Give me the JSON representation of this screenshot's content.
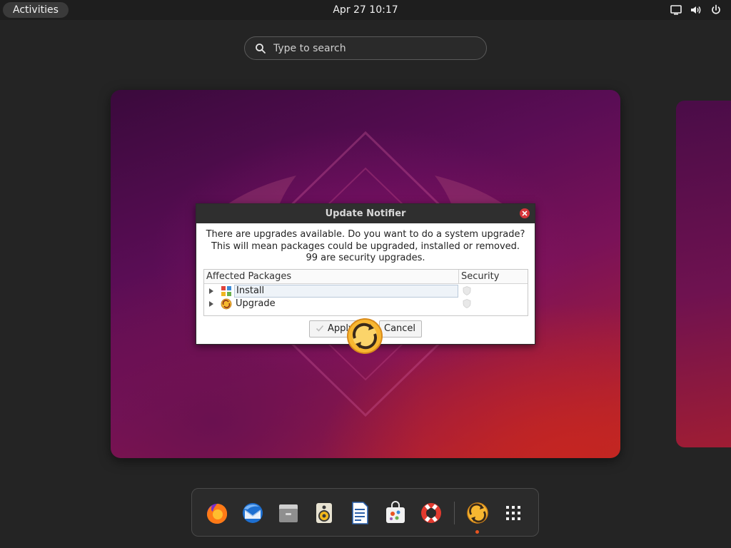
{
  "topbar": {
    "activities_label": "Activities",
    "clock": "Apr 27  10:17",
    "tray_icons": [
      "screen-icon",
      "volume-icon",
      "power-icon"
    ]
  },
  "search": {
    "placeholder": "Type to search"
  },
  "dialog": {
    "title": "Update Notifier",
    "message_lines": [
      "There are upgrades available. Do you want to do a system upgrade?",
      "This will mean packages could be upgraded, installed or removed.",
      "99 are security upgrades."
    ],
    "table": {
      "columns": [
        "Affected Packages",
        "Security"
      ],
      "rows": [
        {
          "label": "Install",
          "icon": "install-icon",
          "selected": true
        },
        {
          "label": "Upgrade",
          "icon": "upgrade-icon",
          "selected": false
        }
      ]
    },
    "buttons": {
      "apply": "Apply",
      "cancel": "Cancel"
    }
  },
  "dock": {
    "items": [
      "firefox-icon",
      "thunderbird-icon",
      "files-icon",
      "rhythmbox-icon",
      "writer-icon",
      "software-icon",
      "help-icon",
      "update-notifier-icon",
      "app-grid-icon"
    ]
  },
  "colors": {
    "accent": "#e95420",
    "close_button": "#d6353a",
    "dialog_titlebar": "#2f2f2f"
  }
}
